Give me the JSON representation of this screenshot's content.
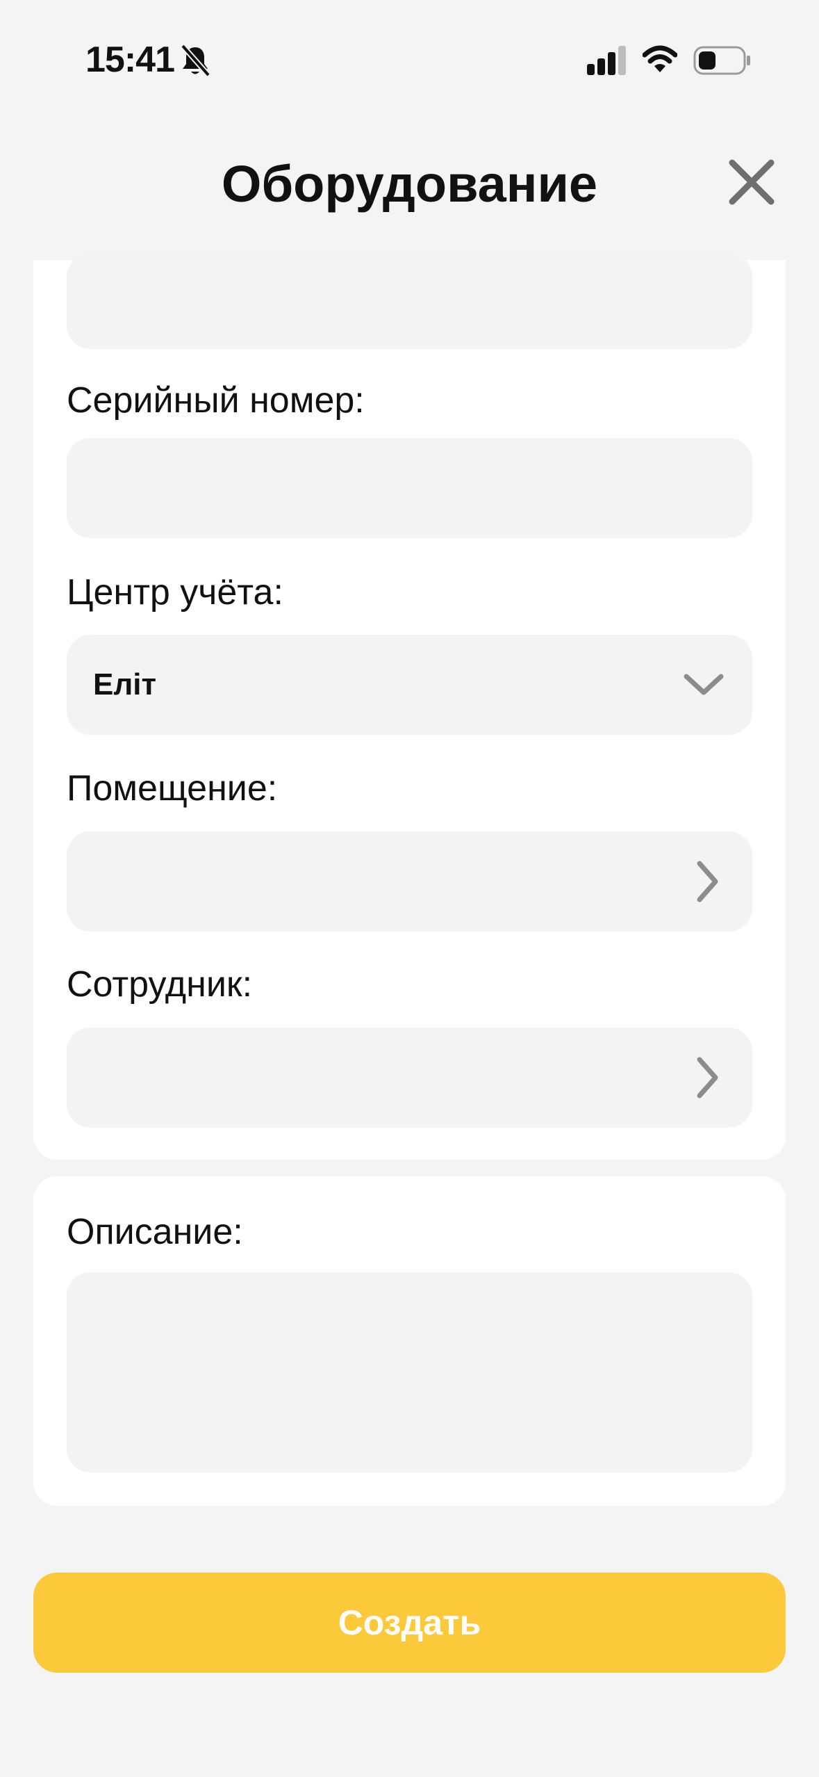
{
  "status_bar": {
    "time": "15:41"
  },
  "header": {
    "title": "Оборудование"
  },
  "form": {
    "serial_label": "Серийный номер:",
    "center_label": "Центр учёта:",
    "center_value": "Еліт",
    "room_label": "Помещение:",
    "employee_label": "Сотрудник:",
    "description_label": "Описание:"
  },
  "actions": {
    "create_label": "Создать"
  },
  "colors": {
    "accent": "#fbc93a",
    "field_bg": "#f2f3f5",
    "page_bg": "#f4f4f4"
  }
}
